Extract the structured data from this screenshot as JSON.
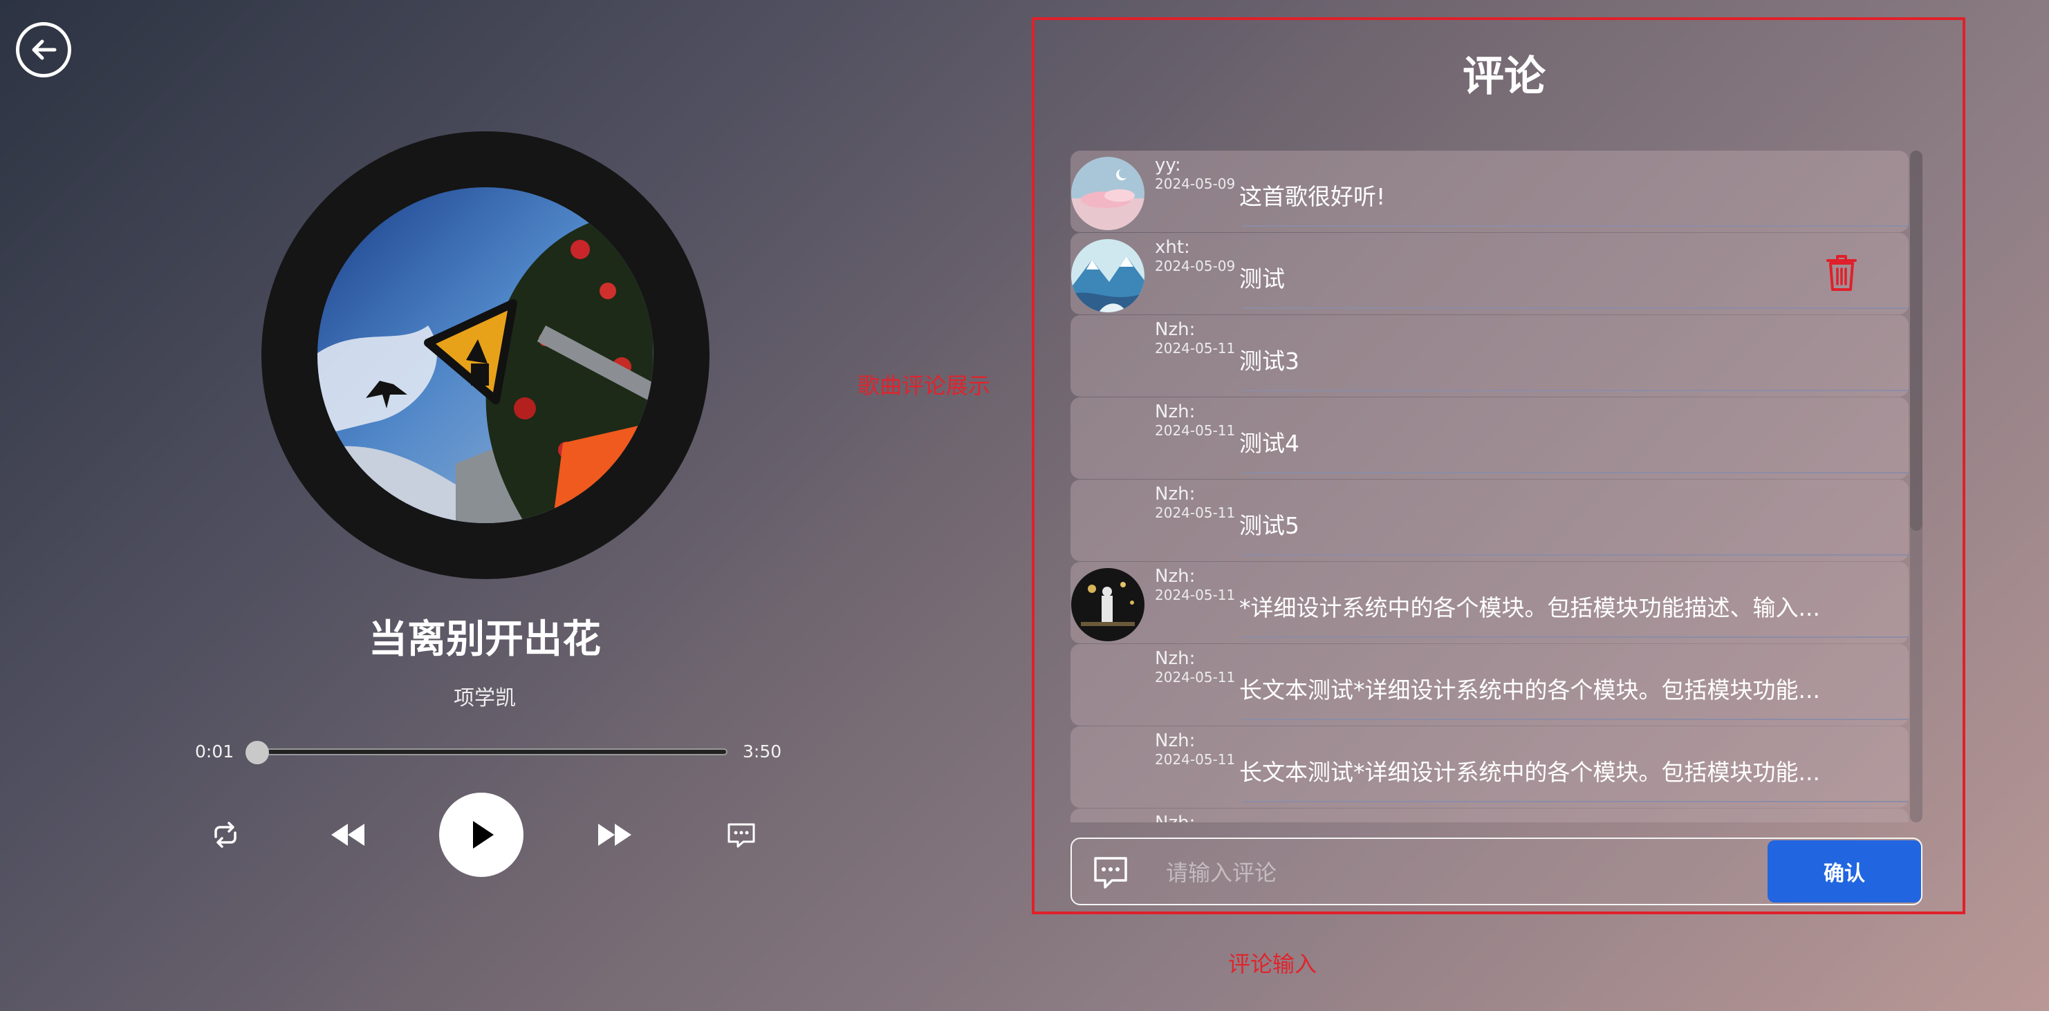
{
  "player": {
    "song_title": "当离别开出花",
    "artist": "项学凯",
    "current_time": "0:01",
    "total_time": "3:50",
    "progress": 0.004
  },
  "comments": {
    "title": "评论",
    "items": [
      {
        "user": "yy:",
        "date": "2024-05-09",
        "text": "这首歌很好听!",
        "avatar": "pink-clouds",
        "deletable": false
      },
      {
        "user": "xht:",
        "date": "2024-05-09",
        "text": "测试",
        "avatar": "blue-mountains",
        "deletable": true
      },
      {
        "user": "Nzh:",
        "date": "2024-05-11",
        "text": "测试3",
        "avatar": "none",
        "deletable": false
      },
      {
        "user": "Nzh:",
        "date": "2024-05-11",
        "text": "测试4",
        "avatar": "none",
        "deletable": false
      },
      {
        "user": "Nzh:",
        "date": "2024-05-11",
        "text": "测试5",
        "avatar": "none",
        "deletable": false
      },
      {
        "user": "Nzh:",
        "date": "2024-05-11",
        "text": "*详细设计系统中的各个模块。包括模块功能描述、输入...",
        "avatar": "night-photo",
        "deletable": false
      },
      {
        "user": "Nzh:",
        "date": "2024-05-11",
        "text": "长文本测试*详细设计系统中的各个模块。包括模块功能...",
        "avatar": "none",
        "deletable": false
      },
      {
        "user": "Nzh:",
        "date": "2024-05-11",
        "text": "长文本测试*详细设计系统中的各个模块。包括模块功能...",
        "avatar": "none",
        "deletable": false
      },
      {
        "user": "Nzh:",
        "date": "",
        "text": "",
        "avatar": "none",
        "deletable": false
      }
    ],
    "input_placeholder": "请输入评论",
    "confirm_label": "确认"
  },
  "annotations": {
    "list_label": "歌曲评论展示",
    "input_label": "评论输入"
  },
  "icons": {
    "back": "back-arrow-icon",
    "repeat": "repeat-icon",
    "previous": "rewind-icon",
    "play": "play-icon",
    "next": "fast-forward-icon",
    "comments": "comment-icon",
    "delete": "trash-icon",
    "input": "comment-input-icon"
  },
  "colors": {
    "accent_red": "#e0202a",
    "confirm_blue": "#2166e0"
  }
}
